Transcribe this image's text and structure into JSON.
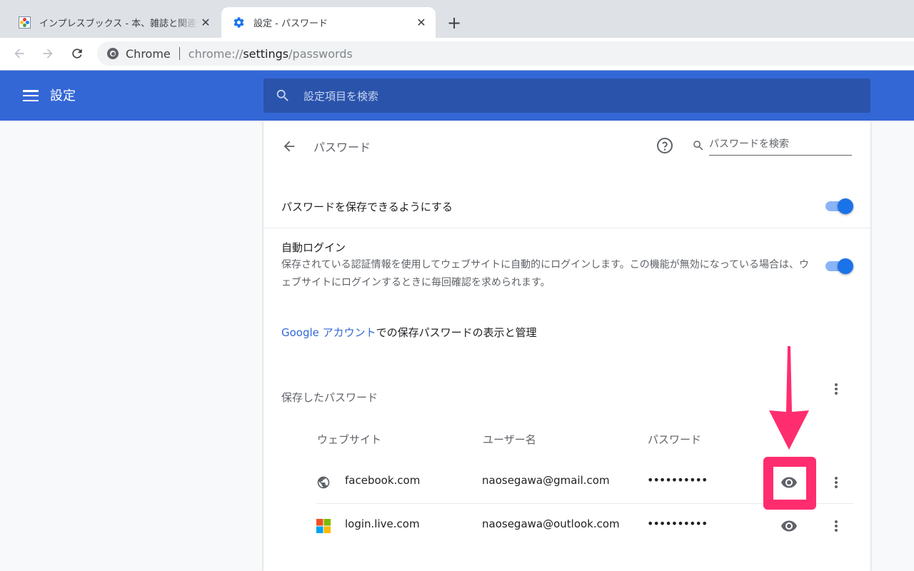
{
  "browser": {
    "tabs": [
      {
        "title": "インプレスブックス - 本、雑誌と関連W",
        "icon": "impress-books-favicon",
        "active": false
      },
      {
        "title": "設定 - パスワード",
        "icon": "gear-icon",
        "active": true
      }
    ],
    "new_tab_label": "+",
    "close_glyph": "✕",
    "omnibox": {
      "site_chip": "Chrome",
      "url_prefix": "chrome://",
      "url_host": "settings",
      "url_path": "/passwords"
    }
  },
  "settings": {
    "header_title": "設定",
    "search_placeholder": "設定項目を検索"
  },
  "passwords_page": {
    "title": "パスワード",
    "search_placeholder": "パスワードを検索",
    "offer_to_save": {
      "label": "パスワードを保存できるようにする",
      "enabled": true
    },
    "auto_signin": {
      "label": "自動ログイン",
      "description": "保存されている認証情報を使用してウェブサイトに自動的にログインします。この機能が無効になっている場合は、ウェブサイトにログインするときに毎回確認を求められます。",
      "enabled": true
    },
    "account_link": {
      "link_text": "Google アカウント",
      "rest_text": "での保存パスワードの表示と管理"
    },
    "saved_section": {
      "title": "保存したパスワード",
      "columns": [
        "ウェブサイト",
        "ユーザー名",
        "パスワード"
      ],
      "rows": [
        {
          "site": "facebook.com",
          "username": "naosegawa@gmail.com",
          "password": "••••••••••",
          "icon": "globe-icon"
        },
        {
          "site": "login.live.com",
          "username": "naosegawa@outlook.com",
          "password": "••••••••••",
          "icon": "microsoft-logo-icon"
        }
      ]
    }
  },
  "annotation": {
    "color": "#ff2d6f",
    "target": "show-password-button (facebook.com)"
  },
  "colors": {
    "header_blue": "#3367d6",
    "search_dark_blue": "#2a53ab",
    "toggle_on": "#1a73e8",
    "toggle_track": "#8ab4f8",
    "link": "#3367d6"
  }
}
